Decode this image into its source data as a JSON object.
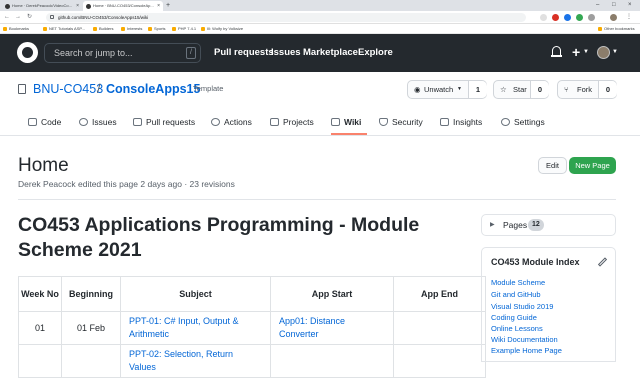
{
  "browser": {
    "tabs": [
      {
        "label": "Home · DerekPeacock/VideoCo..."
      },
      {
        "label": "Home · BNU-CO453/ConsoleAp..."
      }
    ],
    "url": "github.com/BNU-CO453/ConsoleApps15/wiki",
    "bookmarks": [
      "Bookmarks",
      "NET Tutorials ASP...",
      "Builders",
      "Interests",
      "Sports",
      "PHP 7.4.1",
      "Ill: Wolfy by Volksize",
      "Other bookmarks"
    ]
  },
  "header": {
    "search_placeholder": "Search or jump to...",
    "search_shortcut": "/",
    "nav": [
      "Pull requests",
      "Issues",
      "Marketplace",
      "Explore"
    ],
    "plus": "+"
  },
  "repo": {
    "owner": "BNU-CO453",
    "separator": "/",
    "name": "ConsoleApps15",
    "badge": "Template",
    "unwatch_label": "Unwatch",
    "unwatch_count": "1",
    "star_label": "Star",
    "star_count": "0",
    "fork_label": "Fork",
    "fork_count": "0",
    "tabs": [
      "Code",
      "Issues",
      "Pull requests",
      "Actions",
      "Projects",
      "Wiki",
      "Security",
      "Insights",
      "Settings"
    ],
    "active_tab": "Wiki"
  },
  "page": {
    "title": "Home",
    "meta": "Derek Peacock edited this page 2 days ago · 23 revisions",
    "edit_label": "Edit",
    "new_page_label": "New Page",
    "heading": "CO453 Applications Programming - Module Scheme 2021"
  },
  "table": {
    "headers": [
      "Week No",
      "Beginning",
      "Subject",
      "App Start",
      "App End"
    ],
    "rows": [
      {
        "week": "01",
        "beginning": "01 Feb",
        "subject": "PPT-01: C# Input, Output & Arithmetic",
        "app_start": "App01: Distance Converter",
        "app_end": ""
      },
      {
        "week": "",
        "beginning": "",
        "subject": "PPT-02: Selection, Return Values",
        "app_start": "",
        "app_end": ""
      }
    ]
  },
  "sidebar": {
    "pages_label": "Pages",
    "pages_count": "12",
    "index_title": "CO453 Module Index",
    "links": [
      "Module Scheme",
      "Git and GitHub",
      "Visual Studio 2019",
      "Coding Guide",
      "Online Lessons",
      "Wiki Documentation",
      "Example Home Page"
    ]
  },
  "colors": {
    "header_bg": "#24292e",
    "link": "#0366d6",
    "primary_button": "#2ea44f",
    "active_tab_underline": "#f9826c"
  }
}
